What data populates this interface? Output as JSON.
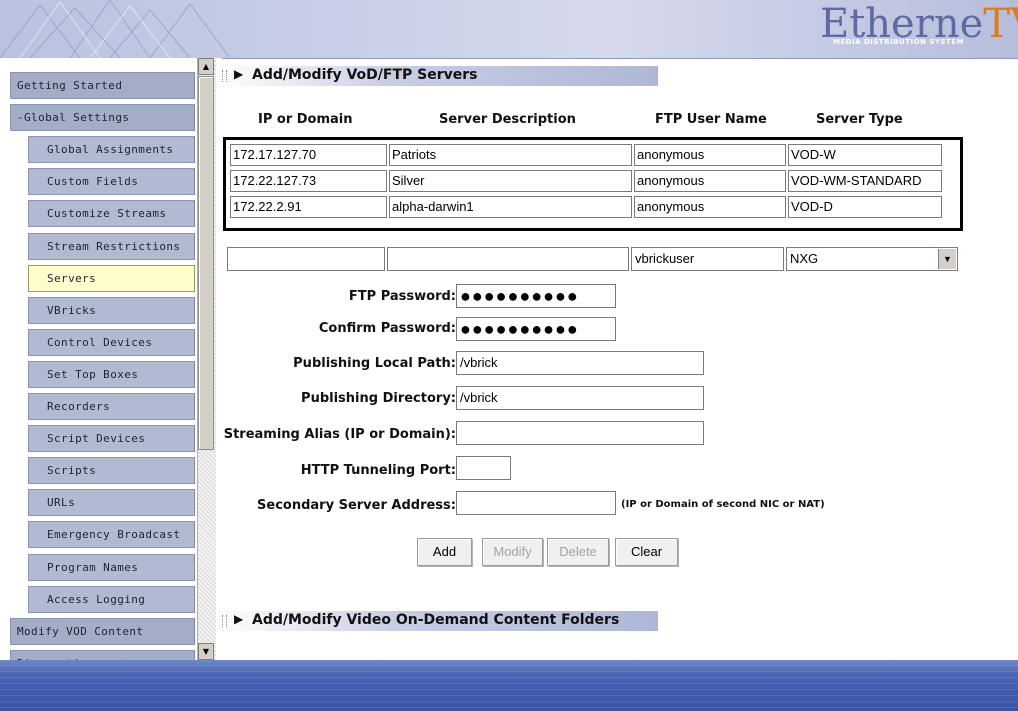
{
  "header": {
    "logo_main": "Etherne",
    "logo_tv": "TV",
    "logo_sub": "MEDIA DISTRIBUTION SYSTEM"
  },
  "nav": {
    "items": [
      {
        "label": "Getting Started",
        "level": "top"
      },
      {
        "label": "-Global Settings",
        "level": "top"
      },
      {
        "label": "Global Assignments",
        "level": "sub"
      },
      {
        "label": "Custom Fields",
        "level": "sub"
      },
      {
        "label": "Customize Streams",
        "level": "sub"
      },
      {
        "label": "Stream Restrictions",
        "level": "sub"
      },
      {
        "label": "Servers",
        "level": "sub",
        "active": true
      },
      {
        "label": "VBricks",
        "level": "sub"
      },
      {
        "label": "Control Devices",
        "level": "sub"
      },
      {
        "label": "Set Top Boxes",
        "level": "sub"
      },
      {
        "label": "Recorders",
        "level": "sub"
      },
      {
        "label": "Script Devices",
        "level": "sub"
      },
      {
        "label": "Scripts",
        "level": "sub"
      },
      {
        "label": "URLs",
        "level": "sub"
      },
      {
        "label": "Emergency Broadcast",
        "level": "sub"
      },
      {
        "label": "Program Names",
        "level": "sub"
      },
      {
        "label": "Access Logging",
        "level": "sub"
      },
      {
        "label": "Modify VOD Content",
        "level": "top"
      },
      {
        "label": "Diagnostics",
        "level": "top"
      }
    ]
  },
  "section1": {
    "title": "Add/Modify VoD/FTP Servers"
  },
  "section2": {
    "title": "Add/Modify Video On-Demand Content Folders"
  },
  "table": {
    "columns": [
      "IP or Domain",
      "Server Description",
      "FTP User Name",
      "Server Type"
    ],
    "rows": [
      [
        "172.17.127.70",
        "Patriots",
        "anonymous",
        "VOD-W"
      ],
      [
        "172.22.127.73",
        "Silver",
        "anonymous",
        "VOD-WM-STANDARD"
      ],
      [
        "172.22.2.91",
        "alpha-darwin1",
        "anonymous",
        "VOD-D"
      ]
    ]
  },
  "new_row": {
    "ip": "",
    "description": "",
    "ftp_user": "vbrickuser",
    "server_type": "NXG"
  },
  "form": {
    "ftp_password_label": "FTP Password:",
    "ftp_password_value": "●●●●●●●●●●",
    "confirm_password_label": "Confirm Password:",
    "confirm_password_value": "●●●●●●●●●●",
    "local_path_label": "Publishing Local Path:",
    "local_path_value": "/vbrick",
    "pub_dir_label": "Publishing Directory:",
    "pub_dir_value": "/vbrick",
    "alias_label": "Streaming Alias (IP or Domain):",
    "alias_value": "",
    "http_port_label": "HTTP Tunneling Port:",
    "http_port_value": "",
    "secondary_label": "Secondary Server Address:",
    "secondary_value": "",
    "secondary_hint": "(IP or Domain of second NIC or NAT)"
  },
  "buttons": {
    "add": "Add",
    "modify": "Modify",
    "delete": "Delete",
    "clear": "Clear"
  },
  "scroll": {
    "up": "▲",
    "down": "▼"
  },
  "icons": {
    "section_arrow": "▶",
    "select_arrow": "▼"
  }
}
